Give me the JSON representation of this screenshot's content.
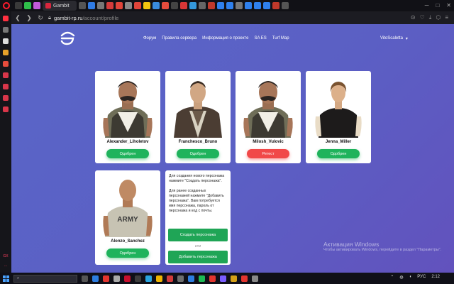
{
  "browser": {
    "active_tab": "Gambit",
    "url_host": "gambit-rp.ru",
    "url_path": "/account/profile",
    "sidebar_label": "GX"
  },
  "nav": {
    "items": [
      "Форум",
      "Правила сервера",
      "Информация о проекте",
      "SA ES",
      "Turf Map"
    ],
    "user": "VitoScaletta"
  },
  "characters": [
    {
      "name": "Alexander_Liholetov",
      "status": "Одобрен",
      "state": "approved"
    },
    {
      "name": "Franchesco_Bruno",
      "status": "Одобрен",
      "state": "approved"
    },
    {
      "name": "Milosh_Vulovic",
      "status": "Ретест",
      "state": "retest"
    },
    {
      "name": "Jenna_Miller",
      "status": "Одобрен",
      "state": "approved"
    },
    {
      "name": "Alonzo_Sanchez",
      "status": "Одобрен",
      "state": "approved"
    }
  ],
  "info": {
    "p1": "Для создания нового персонажа нажмите \"Создать персонажа\".",
    "p2": "Для ранее созданных персонажей нажмите \"Добавить персонажа\". Вам потребуется имя персонажа, пароль от персонажа и код с почты.",
    "create": "Создать персонажа",
    "or": "или",
    "add": "Добавить персонажа"
  },
  "watermark": {
    "title": "Активация Windows",
    "sub": "Чтобы активировать Windows, перейдите в раздел \"Параметры\"."
  },
  "taskbar": {
    "lang": "РУС",
    "time": "2:12"
  },
  "colors": {
    "approved": "#1fb35c",
    "retest": "#f14848",
    "accent": "#5b5fc4"
  }
}
